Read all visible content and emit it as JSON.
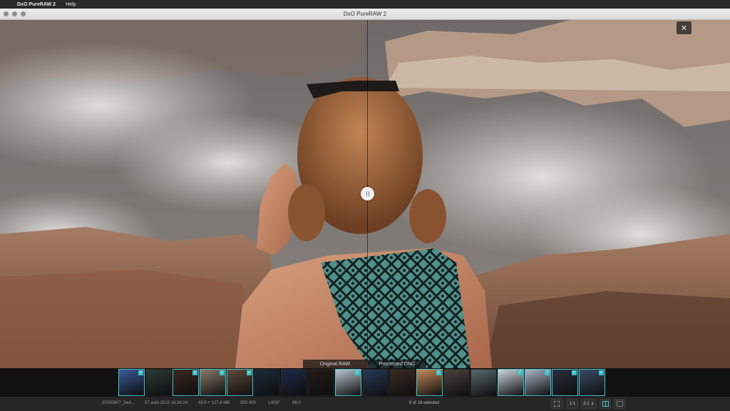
{
  "menubar": {
    "apple_icon": "apple-icon",
    "app_name": "DxO PureRAW 2",
    "help": "Help"
  },
  "window": {
    "title": "DxO PureRAW 2"
  },
  "viewer": {
    "close_label": "✕",
    "split_fraction": 0.503,
    "left_caption": "Original RAW",
    "right_caption": "Processed DNG"
  },
  "filmstrip": {
    "thumbnails": [
      {
        "color": "#3a5a9a",
        "selected": true
      },
      {
        "color": "#2e3b35",
        "selected": false
      },
      {
        "color": "#3a2820",
        "selected": true
      },
      {
        "color": "#8a7a6a",
        "selected": true
      },
      {
        "color": "#5b4b3c",
        "selected": true
      },
      {
        "color": "#1c2a3c",
        "selected": false
      },
      {
        "color": "#1e2b4a",
        "selected": false
      },
      {
        "color": "#241c18",
        "selected": false
      },
      {
        "color": "#b9c4cf",
        "selected": true
      },
      {
        "color": "#2a3a5a",
        "selected": false
      },
      {
        "color": "#3a2a22",
        "selected": false
      },
      {
        "color": "#c48a5a",
        "selected": true
      },
      {
        "color": "#4a4440",
        "selected": false
      },
      {
        "color": "#5a6a70",
        "selected": false
      },
      {
        "color": "#cfd6dc",
        "selected": true
      },
      {
        "color": "#a8b6c8",
        "selected": true
      },
      {
        "color": "#2a3040",
        "selected": true
      },
      {
        "color": "#3a4a66",
        "selected": true
      }
    ]
  },
  "status": {
    "filename": "20150807_Sed...",
    "date": "07 août 2015 18:36:24",
    "size": "43.9 + 127.8 MB",
    "iso": "ISO 400",
    "shutter": "1/800\"",
    "aperture": "f/8.0",
    "selection": "9 of 18 selected",
    "fit_icon": "fit-screen-icon",
    "zoom_1": "1:1",
    "zoom_2": "2:1",
    "split_icon": "split-view-icon",
    "single_icon": "single-view-icon"
  }
}
